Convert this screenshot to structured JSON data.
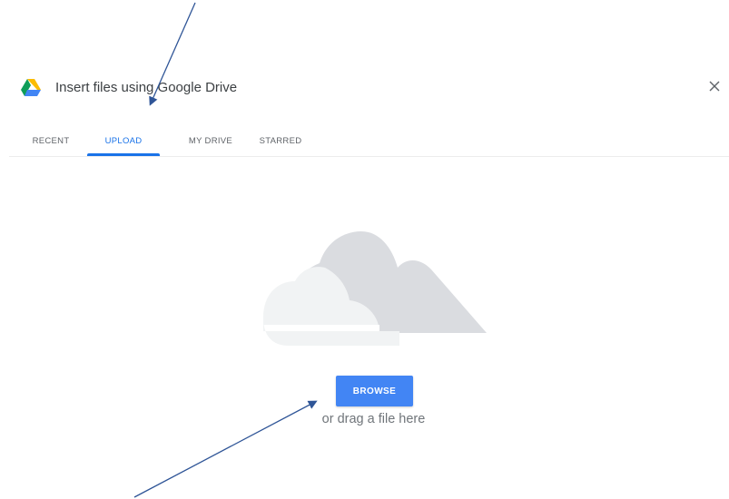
{
  "dialog": {
    "title": "Insert files using Google Drive",
    "close_symbol": "×"
  },
  "tabs": [
    {
      "label": "RECENT",
      "selected": false
    },
    {
      "label": "UPLOAD",
      "selected": true
    },
    {
      "label": "MY DRIVE",
      "selected": false
    },
    {
      "label": "STARRED",
      "selected": false
    }
  ],
  "upload": {
    "browse_label": "BROWSE",
    "drag_hint": "or drag a file here"
  },
  "icons": {
    "logo": "google-drive-icon",
    "close": "close-icon",
    "illustration": "cloud-icon"
  },
  "colors": {
    "accent": "#1a73e8",
    "button": "#4285f4",
    "annotation_arrow": "#2f5597",
    "cloud_back": "#dadce0",
    "cloud_front": "#f1f3f4"
  }
}
